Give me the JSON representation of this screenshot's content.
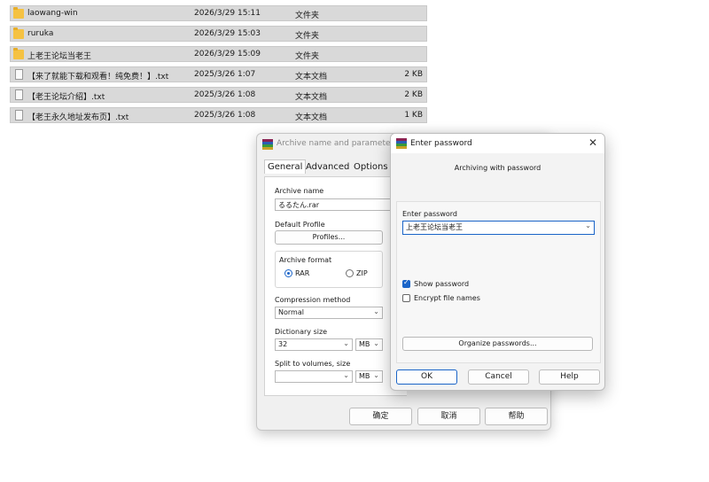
{
  "file_list": {
    "rows": [
      {
        "name": "laowang-win",
        "date": "2026/3/29 15:11",
        "type": "文件夹",
        "size": "",
        "icon": "folder-icon"
      },
      {
        "name": "ruruka",
        "date": "2026/3/29 15:03",
        "type": "文件夹",
        "size": "",
        "icon": "folder-icon"
      },
      {
        "name": "上老王论坛当老王",
        "date": "2026/3/29 15:09",
        "type": "文件夹",
        "size": "",
        "icon": "folder-icon"
      },
      {
        "name": "【来了就能下载和观看！纯免费！】.txt",
        "date": "2025/3/26 1:07",
        "type": "文本文档",
        "size": "2 KB",
        "icon": "text-file-icon"
      },
      {
        "name": "【老王论坛介绍】.txt",
        "date": "2025/3/26 1:08",
        "type": "文本文档",
        "size": "2 KB",
        "icon": "text-file-icon"
      },
      {
        "name": "【老王永久地址发布页】.txt",
        "date": "2025/3/26 1:08",
        "type": "文本文档",
        "size": "1 KB",
        "icon": "text-file-icon"
      }
    ]
  },
  "archive_dialog": {
    "title": "Archive name and parameters",
    "tabs": [
      "General",
      "Advanced",
      "Options"
    ],
    "archive_name_label": "Archive name",
    "archive_name_value": "るるたん.rar",
    "default_profile_label": "Default Profile",
    "profiles_button": "Profiles...",
    "archive_format_label": "Archive format",
    "format_rar": "RAR",
    "format_zip": "ZIP",
    "compression_method_label": "Compression method",
    "compression_method_value": "Normal",
    "dictionary_size_label": "Dictionary size",
    "dictionary_size_value": "32",
    "dictionary_unit": "MB",
    "split_label": "Split to volumes, size",
    "split_value": "",
    "split_unit": "MB",
    "ok_button": "确定",
    "cancel_button": "取消",
    "help_button": "帮助"
  },
  "password_dialog": {
    "title": "Enter password",
    "subtitle": "Archiving with password",
    "enter_password_label": "Enter password",
    "password_value": "上老王论坛当老王",
    "show_password_label": "Show password",
    "show_password_checked": true,
    "encrypt_names_label": "Encrypt file names",
    "encrypt_names_checked": false,
    "organize_button": "Organize passwords...",
    "ok_button": "OK",
    "cancel_button": "Cancel",
    "help_button": "Help"
  },
  "colors": {
    "accent": "#1a64c8",
    "row_bg": "#d9d9d9",
    "folder": "#f5c242"
  }
}
